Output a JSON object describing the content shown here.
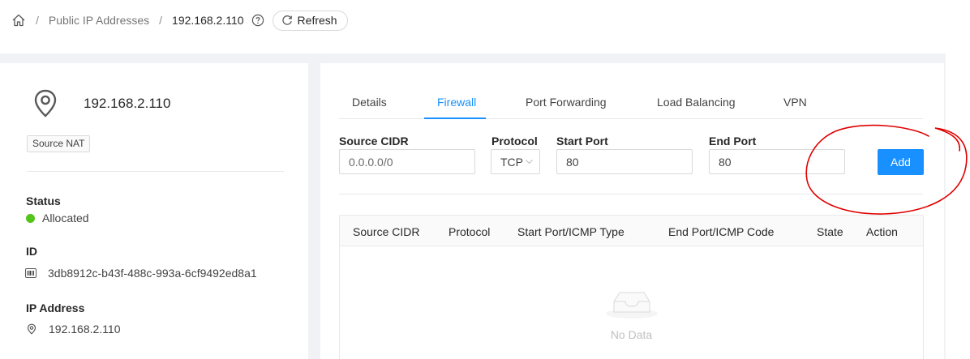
{
  "breadcrumb": {
    "parent": "Public IP Addresses",
    "current": "192.168.2.110"
  },
  "header": {
    "refresh_label": "Refresh"
  },
  "info": {
    "name": "192.168.2.110",
    "tag": "Source NAT",
    "status_label": "Status",
    "status_value": "Allocated",
    "status_color": "#52c41a",
    "id_label": "ID",
    "id_value": "3db8912c-b43f-488c-993a-6cf9492ed8a1",
    "ip_label": "IP Address",
    "ip_value": "192.168.2.110"
  },
  "tabs": [
    {
      "label": "Details"
    },
    {
      "label": "Firewall",
      "active": true
    },
    {
      "label": "Port Forwarding"
    },
    {
      "label": "Load Balancing"
    },
    {
      "label": "VPN"
    }
  ],
  "form": {
    "source_cidr_label": "Source CIDR",
    "source_cidr_placeholder": "0.0.0.0/0",
    "protocol_label": "Protocol",
    "protocol_value": "TCP",
    "start_port_label": "Start Port",
    "start_port_value": "80",
    "end_port_label": "End Port",
    "end_port_value": "80",
    "add_label": "Add"
  },
  "table": {
    "columns": [
      "Source CIDR",
      "Protocol",
      "Start Port/ICMP Type",
      "End Port/ICMP Code",
      "State",
      "Action"
    ],
    "empty_text": "No Data"
  },
  "colors": {
    "accent": "#1890ff",
    "annotation": "#e00000"
  }
}
